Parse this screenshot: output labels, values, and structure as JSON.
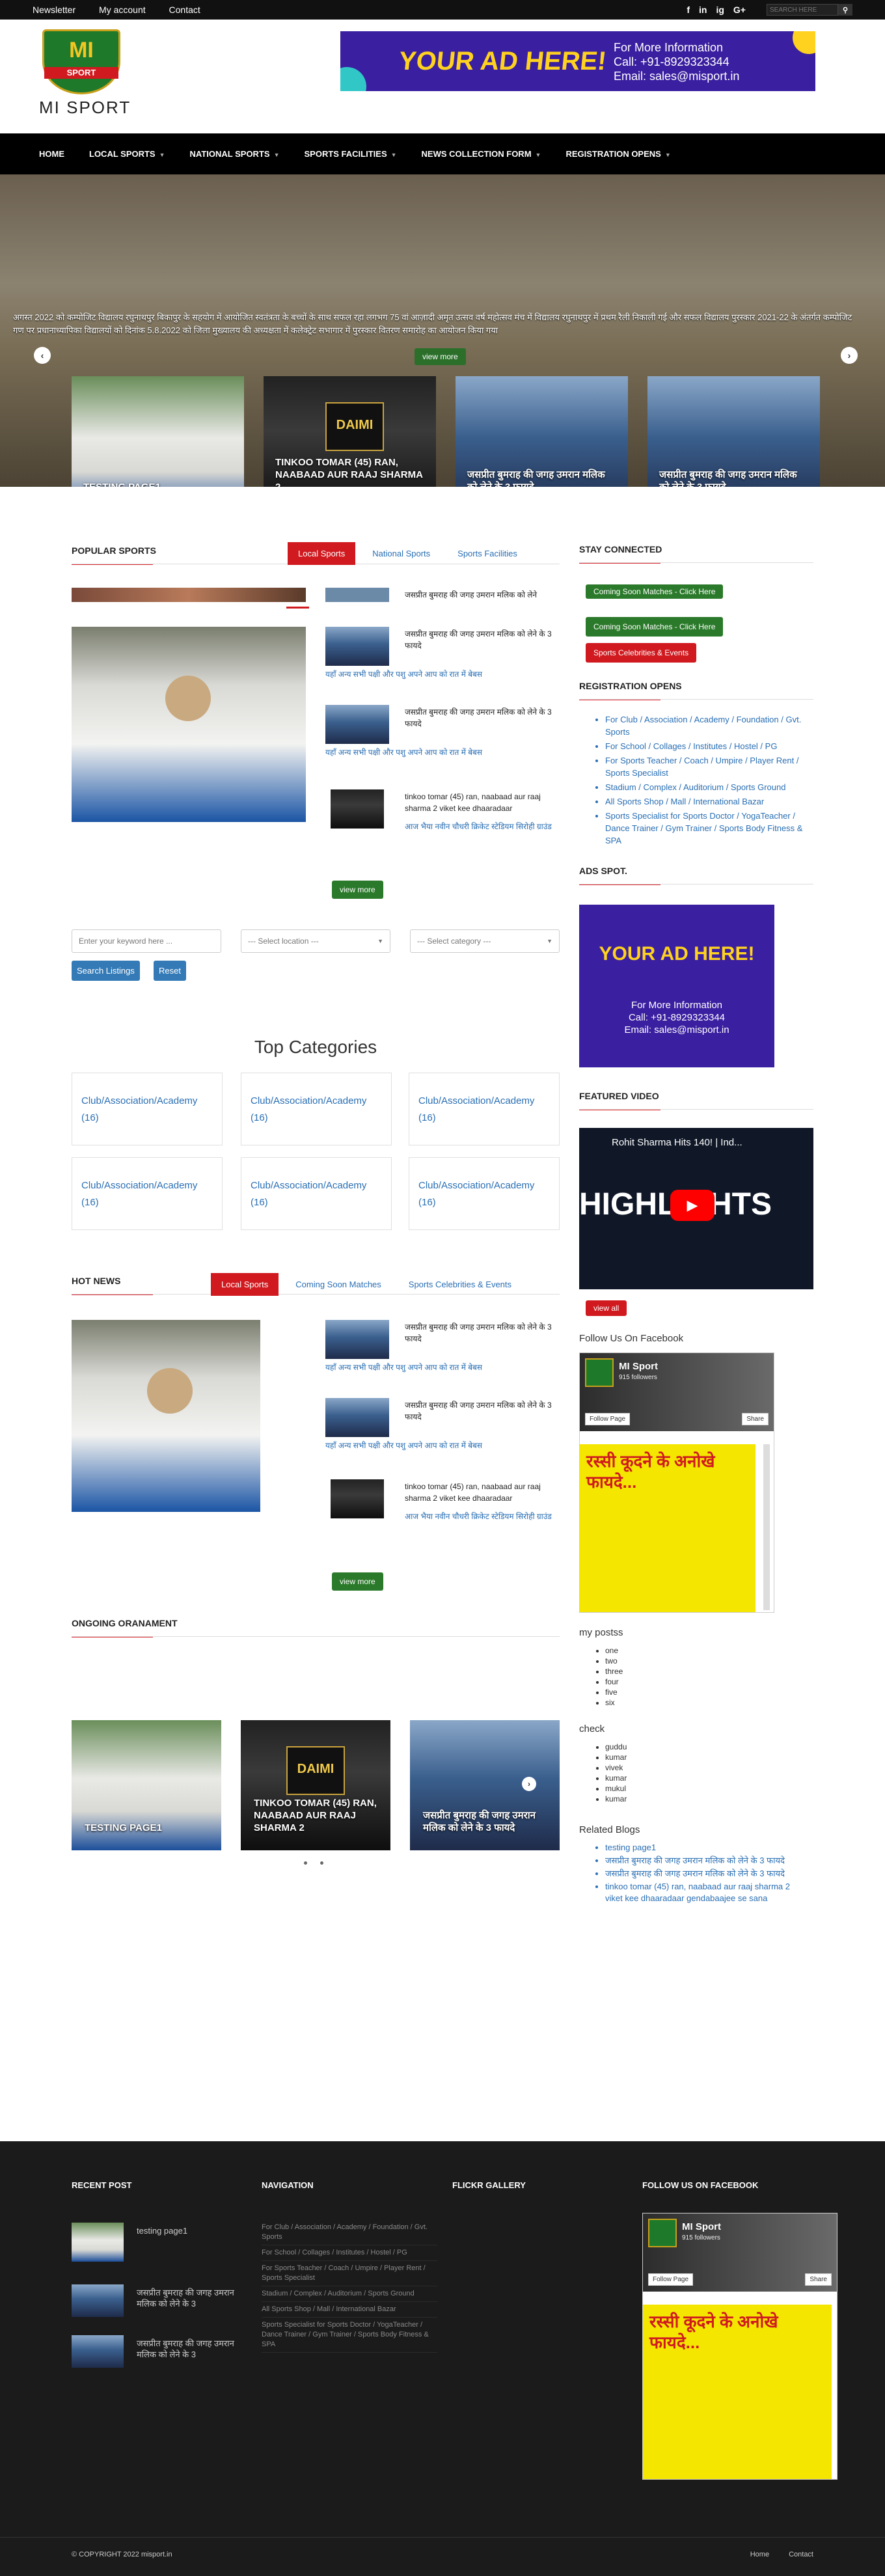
{
  "topbar": {
    "links": [
      "Newsletter",
      "My account",
      "Contact"
    ],
    "social": [
      "f",
      "in",
      "ig",
      "G+"
    ],
    "search_placeholder": "SEARCH HERE"
  },
  "header": {
    "logo_text": "SPORT",
    "logo_letter": "MI",
    "site_name": "MI SPORT",
    "ad": {
      "headline": "YOUR AD HERE!",
      "line1": "For More Information",
      "line2": "Call: +91-8929323344",
      "line3": "Email: sales@misport.in"
    }
  },
  "nav": {
    "items": [
      {
        "label": "HOME",
        "dropdown": false
      },
      {
        "label": "LOCAL SPORTS",
        "dropdown": true
      },
      {
        "label": "NATIONAL SPORTS",
        "dropdown": true
      },
      {
        "label": "SPORTS FACILITIES",
        "dropdown": true
      },
      {
        "label": "NEWS COLLECTION FORM",
        "dropdown": true
      },
      {
        "label": "REGISTRATION OPENS",
        "dropdown": true
      }
    ]
  },
  "hero": {
    "caption": "अगस्त 2022 को कम्पोजिट विद्यालय रघुनाथपुर बिकापुर के सहयोग में आयोजित स्वतंत्रता के बच्चों के साथ सफल रहा लगभग 75 वां आज़ादी अमृत उत्सव वर्ष महोत्सव मंच में विद्यालय रघुनाथपुर में प्रथम रैली निकाली गई और सफल विद्यालय पुरस्कार 2021-22 के अंतर्गत कम्पोजिट गण पर प्रधानाध्यापिका विद्यालयों को दिनांक 5.8.2022 को जिला मुख्यालय की अध्यक्षता में कलेक्ट्रेट सभागार में पुरस्कार वितरण समारोह का आयोजन किया गया",
    "view_more": "view more",
    "thumbs": [
      {
        "caption": "TESTING PAGE1"
      },
      {
        "caption": "TINKOO TOMAR (45) RAN, NAABAAD AUR RAAJ SHARMA 2"
      },
      {
        "caption": "जसप्रीत बुमराह की जगह उमरान मलिक को लेने के 3 फायदे"
      },
      {
        "caption": "जसप्रीत बुमराह की जगह उमरान मलिक को लेने के 3 फायदे"
      }
    ]
  },
  "popular": {
    "title": "POPULAR SPORTS",
    "tabs": [
      "Local Sports",
      "National Sports",
      "Sports Facilities"
    ],
    "top_item_title": "जसप्रीत बुमराह की जगह उमरान मलिक को लेने",
    "items": [
      {
        "title": "जसप्रीत बुमराह की जगह उमरान मलिक को लेने के 3 फायदे",
        "excerpt": "यहाँ अन्य सभी पक्षी और पशु अपने आप को रात में बेबस"
      },
      {
        "title": "जसप्रीत बुमराह की जगह उमरान मलिक को लेने के 3 फायदे",
        "excerpt": "यहाँ अन्य सभी पक्षी और पशु अपने आप को रात में बेबस"
      },
      {
        "title": "tinkoo tomar (45) ran, naabaad aur raaj sharma 2 viket kee dhaaradaar",
        "excerpt": "आज भैया नवीन चौधरी क्रिकेट स्टेडियम सिरोही ग्राउंड"
      }
    ],
    "view_more": "view more"
  },
  "search": {
    "keyword_placeholder": "Enter your keyword here ...",
    "location": "--- Select location ---",
    "category": "--- Select category ---",
    "search_btn": "Search Listings",
    "reset_btn": "Reset"
  },
  "top_categories": {
    "title": "Top Categories",
    "items": [
      {
        "name": "Club/Association/Academy",
        "count": "(16)"
      },
      {
        "name": "Club/Association/Academy",
        "count": "(16)"
      },
      {
        "name": "Club/Association/Academy",
        "count": "(16)"
      },
      {
        "name": "Club/Association/Academy",
        "count": "(16)"
      },
      {
        "name": "Club/Association/Academy",
        "count": "(16)"
      },
      {
        "name": "Club/Association/Academy",
        "count": "(16)"
      }
    ]
  },
  "hotnews": {
    "title": "HOT NEWS",
    "tabs": [
      "Local Sports",
      "Coming Soon Matches",
      "Sports Celebrities & Events"
    ],
    "items": [
      {
        "title": "जसप्रीत बुमराह की जगह उमरान मलिक को लेने के 3 फायदे",
        "excerpt": "यहाँ अन्य सभी पक्षी और पशु अपने आप को रात में बेबस"
      },
      {
        "title": "जसप्रीत बुमराह की जगह उमरान मलिक को लेने के 3 फायदे",
        "excerpt": "यहाँ अन्य सभी पक्षी और पशु अपने आप को रात में बेबस"
      },
      {
        "title": "tinkoo tomar (45) ran, naabaad aur raaj sharma 2 viket kee dhaaradaar",
        "excerpt": "आज भैया नवीन चौधरी क्रिकेट स्टेडियम सिरोही ग्राउंड"
      }
    ],
    "view_more": "view more"
  },
  "ongoing": {
    "title": "ONGOING ORANAMENT",
    "items": [
      {
        "caption": "TESTING PAGE1"
      },
      {
        "caption": "TINKOO TOMAR (45) RAN, NAABAAD AUR RAAJ SHARMA 2"
      },
      {
        "caption": "जसप्रीत बुमराह की जगह उमरान मलिक को लेने के 3 फायदे"
      }
    ]
  },
  "sidebar": {
    "stay_title": "STAY CONNECTED",
    "btn1": "Coming Soon Matches - Click Here",
    "btn2": "Coming Soon Matches - Click Here",
    "btn3": "Sports Celebrities & Events",
    "reg_title": "REGISTRATION OPENS",
    "reg_items": [
      "For Club / Association / Academy / Foundation / Gvt. Sports",
      "For School / Collages / Institutes / Hostel / PG",
      "For Sports Teacher / Coach / Umpire / Player Rent / Sports Specialist",
      "Stadium / Complex / Auditorium / Sports Ground",
      "All Sports Shop / Mall / International Bazar",
      "Sports Specialist for Sports Doctor / YogaTeacher / Dance Trainer / Gym Trainer / Sports Body Fitness & SPA"
    ],
    "ads_title": "ADS SPOT.",
    "ad": {
      "headline": "YOUR AD HERE!",
      "line1": "For More Information",
      "line2": "Call: +91-8929323344",
      "line3": "Email: sales@misport.in"
    },
    "video_title": "FEATURED VIDEO",
    "video": {
      "title": "Rohit Sharma Hits 140! | Ind...",
      "overlay": "HIGHLIGHTS"
    },
    "view_all": "view all",
    "fb_title": "Follow Us On Facebook",
    "fb": {
      "name": "MI Sport",
      "followers": "915 followers",
      "follow": "Follow Page",
      "share": "Share",
      "post": "रस्सी कूदने के अनोखे फायदे..."
    },
    "myposts_title": "my postss",
    "myposts": [
      "one",
      "two",
      "three",
      "four",
      "five",
      "six"
    ],
    "check_title": "check",
    "check": [
      "guddu",
      "kumar",
      "vivek",
      "kumar",
      "mukul",
      "kumar"
    ],
    "related_title": "Related Blogs",
    "related": [
      "testing page1",
      "जसप्रीत बुमराह की जगह उमरान मलिक को लेने के 3 फायदे",
      "जसप्रीत बुमराह की जगह उमरान मलिक को लेने के 3 फायदे",
      "tinkoo tomar (45) ran, naabaad aur raaj sharma 2 viket kee dhaaradaar gendabaajee se sana"
    ]
  },
  "footer": {
    "recent_title": "RECENT POST",
    "recent": [
      "testing page1",
      "जसप्रीत बुमराह की जगह उमरान मलिक को लेने के 3",
      "जसप्रीत बुमराह की जगह उमरान मलिक को लेने के 3"
    ],
    "nav_title": "NAVIGATION",
    "nav": [
      "For Club / Association / Academy / Foundation / Gvt. Sports",
      "For School / Collages / Institutes / Hostel / PG",
      "For Sports Teacher / Coach / Umpire / Player Rent / Sports Specialist",
      "Stadium / Complex / Auditorium / Sports Ground",
      "All Sports Shop / Mall / International Bazar",
      "Sports Specialist for Sports Doctor / YogaTeacher / Dance Trainer / Gym Trainer / Sports Body Fitness & SPA"
    ],
    "flickr_title": "FLICKR GALLERY",
    "fb_title": "FOLLOW US ON FACEBOOK",
    "fb": {
      "name": "MI Sport",
      "followers": "915 followers",
      "follow": "Follow Page",
      "share": "Share",
      "post": "रस्सी कूदने के अनोखे फायदे..."
    },
    "copyright": "© COPYRIGHT 2022 misport.in",
    "links": [
      "Home",
      "Contact"
    ]
  },
  "colors": {
    "accent": "#d01a20",
    "green": "#2b7a2b",
    "link": "#2a6fb4",
    "dark": "#111111"
  }
}
